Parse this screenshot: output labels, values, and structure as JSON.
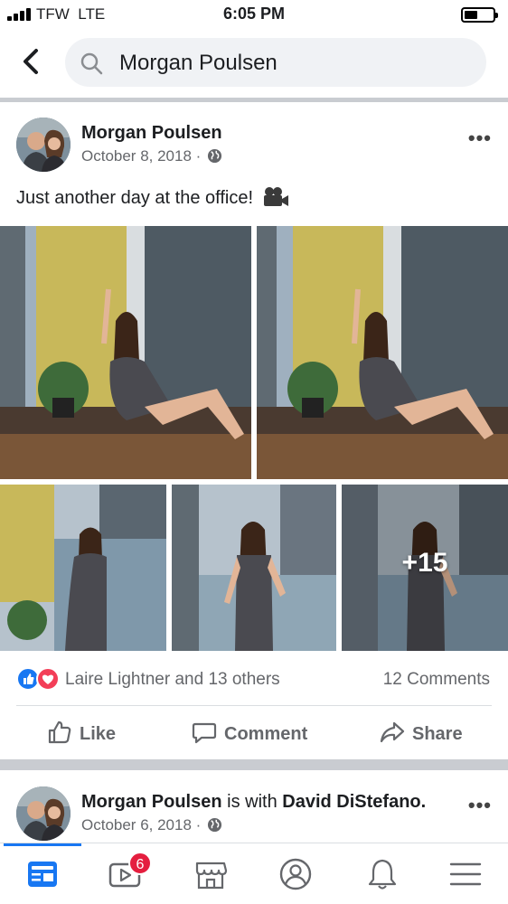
{
  "status_bar": {
    "carrier": "TFW",
    "network": "LTE",
    "time": "6:05 PM"
  },
  "search": {
    "query": "Morgan Poulsen",
    "icon": "search-icon"
  },
  "post1": {
    "author": "Morgan Poulsen",
    "date": "October 8, 2018",
    "separator": "·",
    "privacy_icon": "globe-icon",
    "text": "Just another day at the office!",
    "more_label": "•••",
    "extra_photos": "+15",
    "reaction_names": "Laire Lightner and 13 others",
    "comments_count": "12 Comments",
    "actions": {
      "like": "Like",
      "comment": "Comment",
      "share": "Share"
    }
  },
  "post2": {
    "author": "Morgan Poulsen",
    "with_text": "is with",
    "tagged": "David DiStefano.",
    "date": "October 6, 2018",
    "separator": "·",
    "more_label": "•••"
  },
  "nav": {
    "tabs": [
      "news-feed-icon",
      "watch-icon",
      "marketplace-icon",
      "profile-icon",
      "notifications-icon",
      "menu-icon"
    ],
    "watch_badge": "6",
    "accent": "#1877f2"
  }
}
